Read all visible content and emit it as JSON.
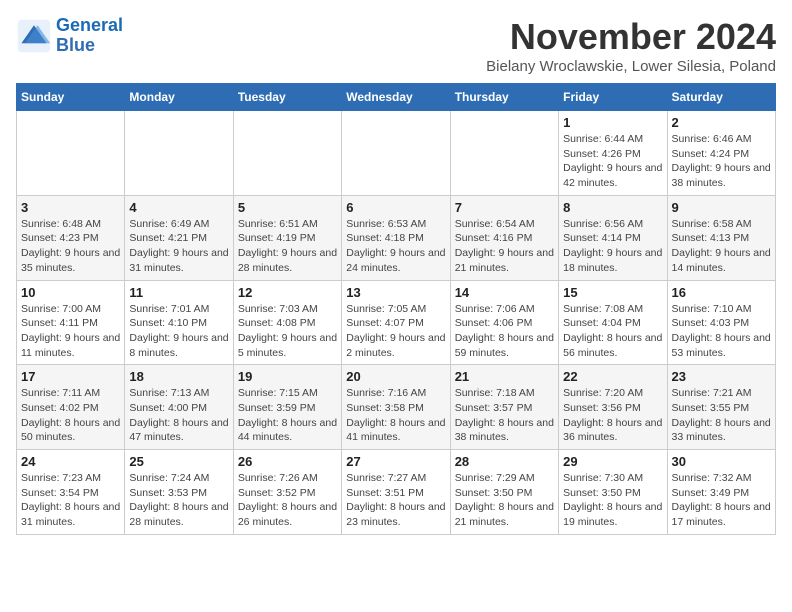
{
  "header": {
    "logo_line1": "General",
    "logo_line2": "Blue",
    "month_title": "November 2024",
    "subtitle": "Bielany Wroclawskie, Lower Silesia, Poland"
  },
  "weekdays": [
    "Sunday",
    "Monday",
    "Tuesday",
    "Wednesday",
    "Thursday",
    "Friday",
    "Saturday"
  ],
  "weeks": [
    [
      {
        "day": "",
        "info": ""
      },
      {
        "day": "",
        "info": ""
      },
      {
        "day": "",
        "info": ""
      },
      {
        "day": "",
        "info": ""
      },
      {
        "day": "",
        "info": ""
      },
      {
        "day": "1",
        "info": "Sunrise: 6:44 AM\nSunset: 4:26 PM\nDaylight: 9 hours\nand 42 minutes."
      },
      {
        "day": "2",
        "info": "Sunrise: 6:46 AM\nSunset: 4:24 PM\nDaylight: 9 hours\nand 38 minutes."
      }
    ],
    [
      {
        "day": "3",
        "info": "Sunrise: 6:48 AM\nSunset: 4:23 PM\nDaylight: 9 hours\nand 35 minutes."
      },
      {
        "day": "4",
        "info": "Sunrise: 6:49 AM\nSunset: 4:21 PM\nDaylight: 9 hours\nand 31 minutes."
      },
      {
        "day": "5",
        "info": "Sunrise: 6:51 AM\nSunset: 4:19 PM\nDaylight: 9 hours\nand 28 minutes."
      },
      {
        "day": "6",
        "info": "Sunrise: 6:53 AM\nSunset: 4:18 PM\nDaylight: 9 hours\nand 24 minutes."
      },
      {
        "day": "7",
        "info": "Sunrise: 6:54 AM\nSunset: 4:16 PM\nDaylight: 9 hours\nand 21 minutes."
      },
      {
        "day": "8",
        "info": "Sunrise: 6:56 AM\nSunset: 4:14 PM\nDaylight: 9 hours\nand 18 minutes."
      },
      {
        "day": "9",
        "info": "Sunrise: 6:58 AM\nSunset: 4:13 PM\nDaylight: 9 hours\nand 14 minutes."
      }
    ],
    [
      {
        "day": "10",
        "info": "Sunrise: 7:00 AM\nSunset: 4:11 PM\nDaylight: 9 hours\nand 11 minutes."
      },
      {
        "day": "11",
        "info": "Sunrise: 7:01 AM\nSunset: 4:10 PM\nDaylight: 9 hours\nand 8 minutes."
      },
      {
        "day": "12",
        "info": "Sunrise: 7:03 AM\nSunset: 4:08 PM\nDaylight: 9 hours\nand 5 minutes."
      },
      {
        "day": "13",
        "info": "Sunrise: 7:05 AM\nSunset: 4:07 PM\nDaylight: 9 hours\nand 2 minutes."
      },
      {
        "day": "14",
        "info": "Sunrise: 7:06 AM\nSunset: 4:06 PM\nDaylight: 8 hours\nand 59 minutes."
      },
      {
        "day": "15",
        "info": "Sunrise: 7:08 AM\nSunset: 4:04 PM\nDaylight: 8 hours\nand 56 minutes."
      },
      {
        "day": "16",
        "info": "Sunrise: 7:10 AM\nSunset: 4:03 PM\nDaylight: 8 hours\nand 53 minutes."
      }
    ],
    [
      {
        "day": "17",
        "info": "Sunrise: 7:11 AM\nSunset: 4:02 PM\nDaylight: 8 hours\nand 50 minutes."
      },
      {
        "day": "18",
        "info": "Sunrise: 7:13 AM\nSunset: 4:00 PM\nDaylight: 8 hours\nand 47 minutes."
      },
      {
        "day": "19",
        "info": "Sunrise: 7:15 AM\nSunset: 3:59 PM\nDaylight: 8 hours\nand 44 minutes."
      },
      {
        "day": "20",
        "info": "Sunrise: 7:16 AM\nSunset: 3:58 PM\nDaylight: 8 hours\nand 41 minutes."
      },
      {
        "day": "21",
        "info": "Sunrise: 7:18 AM\nSunset: 3:57 PM\nDaylight: 8 hours\nand 38 minutes."
      },
      {
        "day": "22",
        "info": "Sunrise: 7:20 AM\nSunset: 3:56 PM\nDaylight: 8 hours\nand 36 minutes."
      },
      {
        "day": "23",
        "info": "Sunrise: 7:21 AM\nSunset: 3:55 PM\nDaylight: 8 hours\nand 33 minutes."
      }
    ],
    [
      {
        "day": "24",
        "info": "Sunrise: 7:23 AM\nSunset: 3:54 PM\nDaylight: 8 hours\nand 31 minutes."
      },
      {
        "day": "25",
        "info": "Sunrise: 7:24 AM\nSunset: 3:53 PM\nDaylight: 8 hours\nand 28 minutes."
      },
      {
        "day": "26",
        "info": "Sunrise: 7:26 AM\nSunset: 3:52 PM\nDaylight: 8 hours\nand 26 minutes."
      },
      {
        "day": "27",
        "info": "Sunrise: 7:27 AM\nSunset: 3:51 PM\nDaylight: 8 hours\nand 23 minutes."
      },
      {
        "day": "28",
        "info": "Sunrise: 7:29 AM\nSunset: 3:50 PM\nDaylight: 8 hours\nand 21 minutes."
      },
      {
        "day": "29",
        "info": "Sunrise: 7:30 AM\nSunset: 3:50 PM\nDaylight: 8 hours\nand 19 minutes."
      },
      {
        "day": "30",
        "info": "Sunrise: 7:32 AM\nSunset: 3:49 PM\nDaylight: 8 hours\nand 17 minutes."
      }
    ]
  ]
}
